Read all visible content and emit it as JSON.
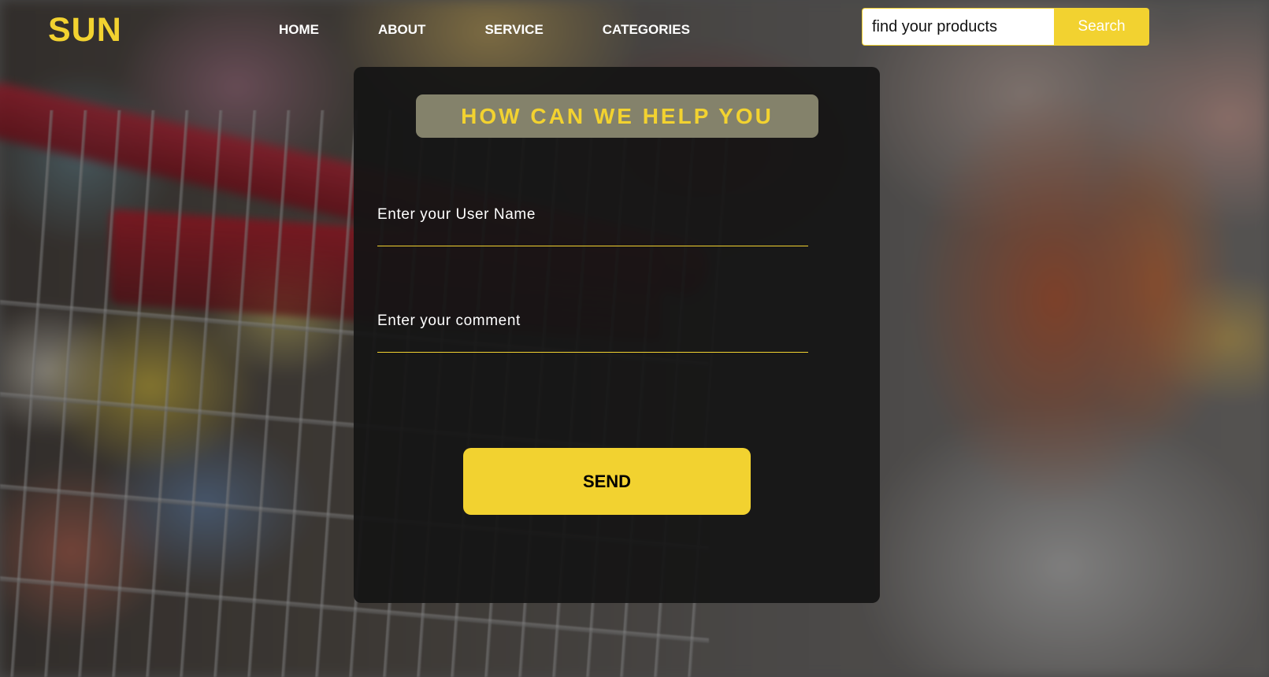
{
  "brand": {
    "logo_text": "SUN"
  },
  "nav": {
    "items": [
      {
        "label": "HOME"
      },
      {
        "label": "ABOUT"
      },
      {
        "label": "SERVICE"
      },
      {
        "label": "CATEGORIES"
      }
    ]
  },
  "search": {
    "placeholder": "find your products",
    "value": "",
    "button_label": "Search"
  },
  "form": {
    "title": "HOW CAN WE HELP YOU",
    "username": {
      "placeholder": "Enter your User Name",
      "value": ""
    },
    "comment": {
      "placeholder": "Enter your comment",
      "value": ""
    },
    "send_label": "SEND"
  },
  "theme": {
    "accent": "#f2d230",
    "panel": "#141414",
    "title_box": "#84826b",
    "nav_text": "#ffffff"
  },
  "background": {
    "icon": "supermarket-cart-photo"
  }
}
